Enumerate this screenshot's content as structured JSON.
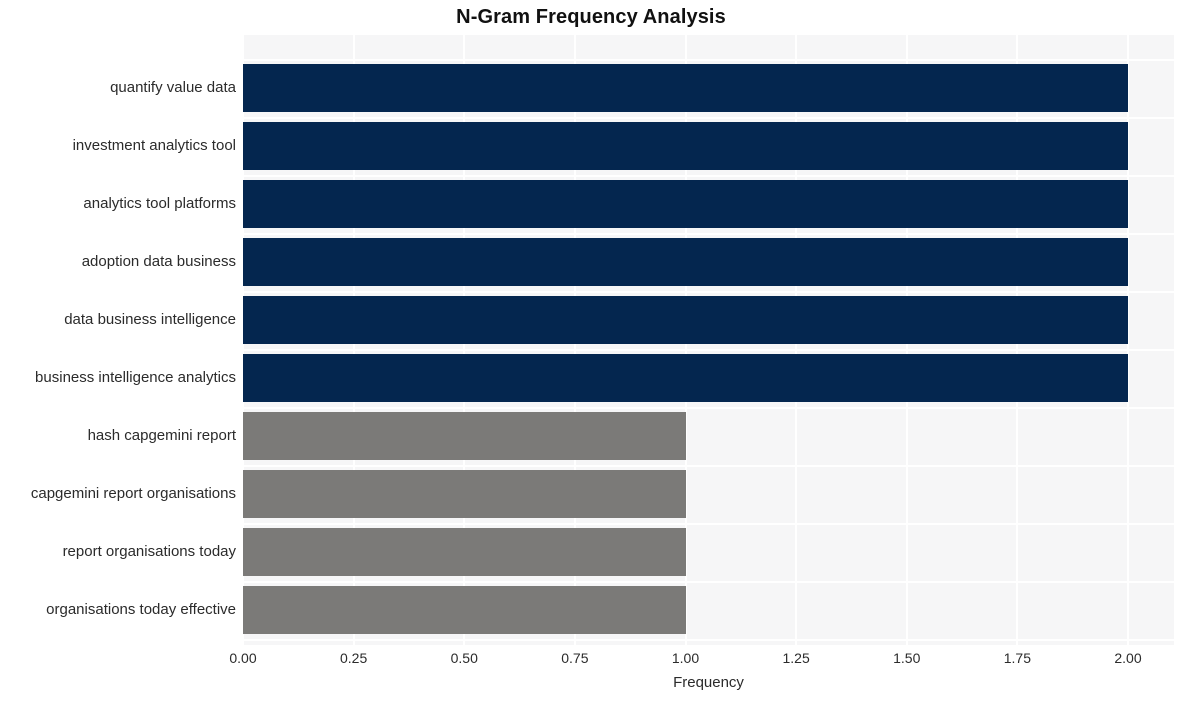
{
  "chart_data": {
    "type": "bar",
    "orientation": "horizontal",
    "title": "N-Gram Frequency Analysis",
    "xlabel": "Frequency",
    "ylabel": "",
    "xlim": [
      0.0,
      2.0
    ],
    "grid": true,
    "legend": null,
    "categories": [
      "quantify value data",
      "investment analytics tool",
      "analytics tool platforms",
      "adoption data business",
      "data business intelligence",
      "business intelligence analytics",
      "hash capgemini report",
      "capgemini report organisations",
      "report organisations today",
      "organisations today effective"
    ],
    "values": [
      2,
      2,
      2,
      2,
      2,
      2,
      1,
      1,
      1,
      1
    ],
    "bar_colors": [
      "#04264f",
      "#04264f",
      "#04264f",
      "#04264f",
      "#04264f",
      "#04264f",
      "#7b7a78",
      "#7b7a78",
      "#7b7a78",
      "#7b7a78"
    ],
    "xticks": [
      "0.00",
      "0.25",
      "0.50",
      "0.75",
      "1.00",
      "1.25",
      "1.50",
      "1.75",
      "2.00"
    ],
    "xtick_values": [
      0.0,
      0.25,
      0.5,
      0.75,
      1.0,
      1.25,
      1.5,
      1.75,
      2.0
    ],
    "plot_background": "#f6f6f7",
    "grid_color": "#ffffff",
    "figure_background": "#ffffff",
    "title_color": "#111111",
    "tick_label_color": "#2b2b2b"
  }
}
